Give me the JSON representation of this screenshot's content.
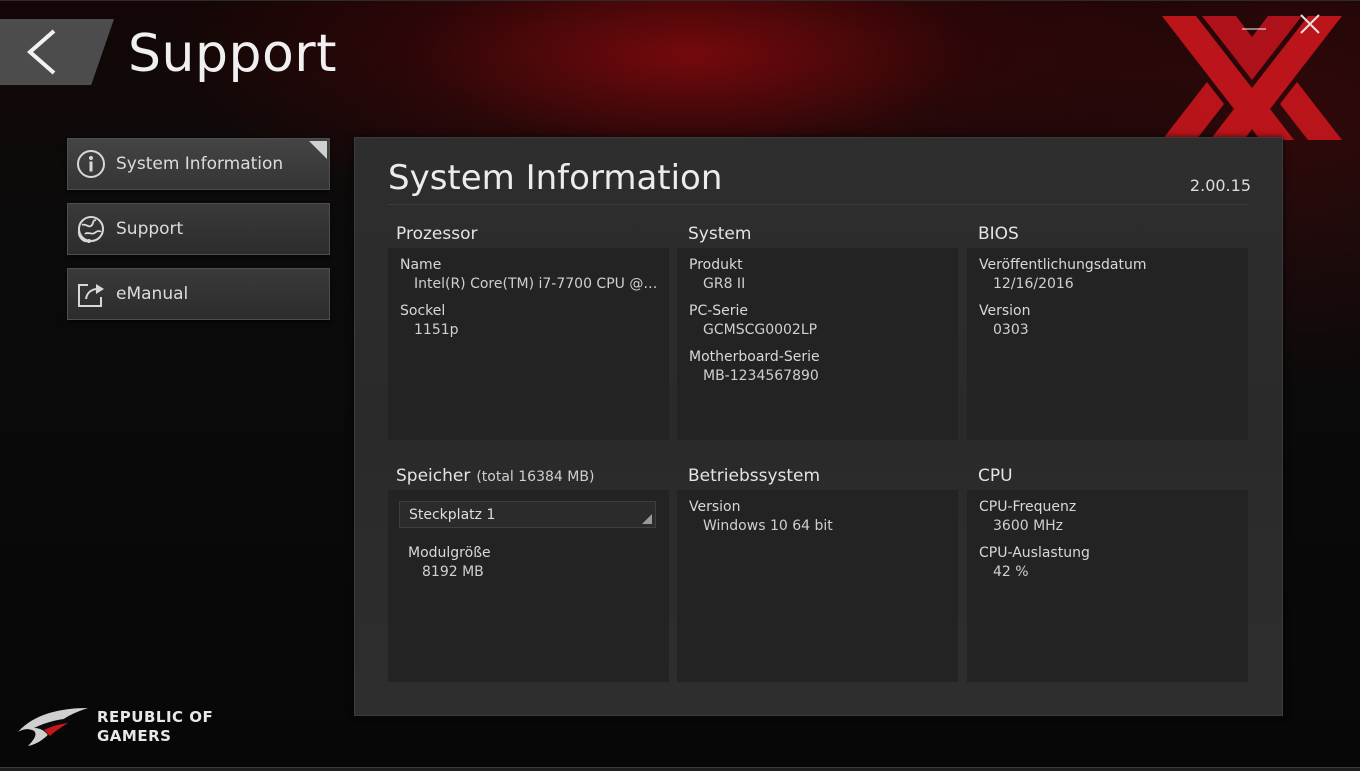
{
  "header": {
    "title": "Support"
  },
  "sidebar": {
    "items": [
      {
        "label": "System Information",
        "icon": "info-icon",
        "active": true
      },
      {
        "label": "Support",
        "icon": "support-globe-icon",
        "active": false
      },
      {
        "label": "eManual",
        "icon": "share-export-icon",
        "active": false
      }
    ]
  },
  "panel": {
    "title": "System Information",
    "version": "2.00.15",
    "processor": {
      "heading": "Prozessor",
      "name_label": "Name",
      "name_value": "Intel(R) Core(TM) i7-7700 CPU @ 3.60...",
      "socket_label": "Sockel",
      "socket_value": "1151p"
    },
    "system": {
      "heading": "System",
      "product_label": "Produkt",
      "product_value": "GR8 II",
      "pc_series_label": "PC-Serie",
      "pc_series_value": "GCMSCG0002LP",
      "mb_series_label": "Motherboard-Serie",
      "mb_series_value": "MB-1234567890"
    },
    "bios": {
      "heading": "BIOS",
      "date_label": "Veröffentlichungsdatum",
      "date_value": "12/16/2016",
      "version_label": "Version",
      "version_value": "0303"
    },
    "memory": {
      "heading": "Speicher",
      "total": "(total 16384 MB)",
      "slot_selected": "Steckplatz 1",
      "module_size_label": "Modulgröße",
      "module_size_value": "8192 MB"
    },
    "os": {
      "heading": "Betriebssystem",
      "version_label": "Version",
      "version_value": "Windows 10 64 bit"
    },
    "cpu": {
      "heading": "CPU",
      "freq_label": "CPU-Frequenz",
      "freq_value": "3600 MHz",
      "load_label": "CPU-Auslastung",
      "load_value": "42 %"
    }
  },
  "footer": {
    "brand_line1": "REPUBLIC OF",
    "brand_line2": "GAMERS"
  },
  "colors": {
    "accent_red": "#c8161d",
    "panel_bg": "#2c2c2c",
    "card_bg": "#232323"
  }
}
